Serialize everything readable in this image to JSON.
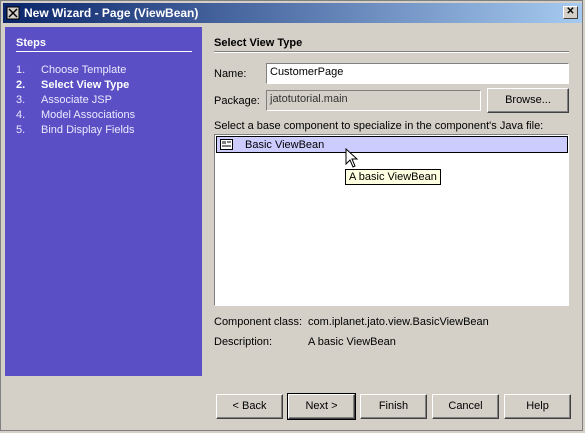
{
  "window": {
    "title": "New Wizard - Page (ViewBean)"
  },
  "steps": {
    "title": "Steps",
    "items": [
      {
        "num": "1.",
        "label": "Choose Template"
      },
      {
        "num": "2.",
        "label": "Select View Type"
      },
      {
        "num": "3.",
        "label": "Associate JSP"
      },
      {
        "num": "4.",
        "label": "Model Associations"
      },
      {
        "num": "5.",
        "label": "Bind Display Fields"
      }
    ]
  },
  "main": {
    "title": "Select View Type",
    "name_label": "Name:",
    "name_value": "CustomerPage",
    "package_label": "Package:",
    "package_value": "jatotutorial.main",
    "browse_label": "Browse...",
    "list_label": "Select a base component to specialize in the component's Java file:",
    "list_items": [
      "Basic ViewBean"
    ],
    "tooltip": "A basic ViewBean",
    "component_class_label": "Component class:",
    "component_class_value": "com.iplanet.jato.view.BasicViewBean",
    "description_label": "Description:",
    "description_value": "A basic ViewBean"
  },
  "buttons": {
    "back": "< Back",
    "next": "Next >",
    "finish": "Finish",
    "cancel": "Cancel",
    "help": "Help"
  }
}
